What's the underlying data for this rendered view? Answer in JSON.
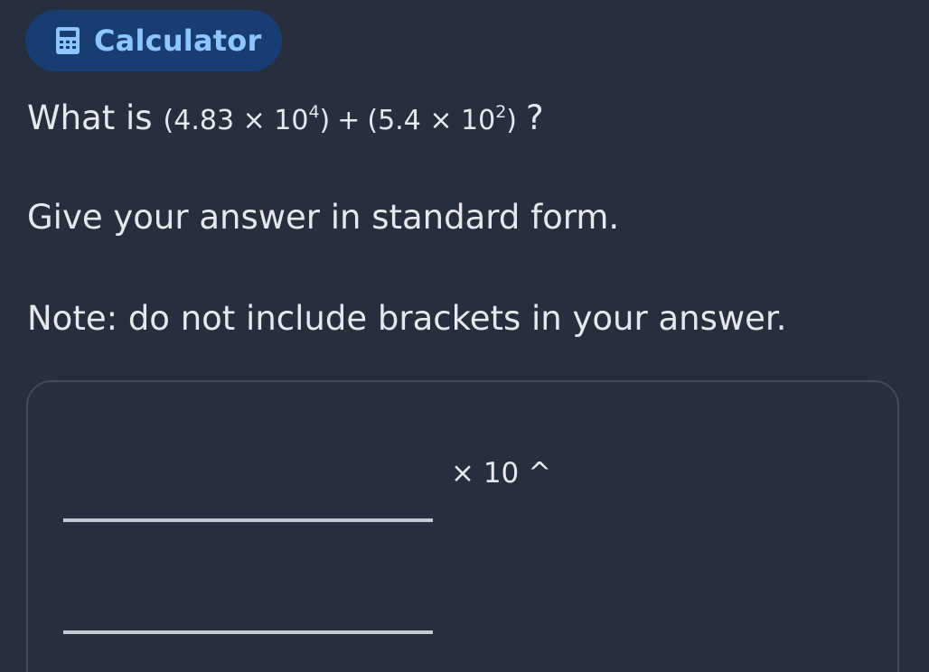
{
  "calculator_button": {
    "label": "Calculator",
    "icon": "calculator-icon",
    "background": "#173d73",
    "text_color": "#8ec5ff"
  },
  "question": {
    "prefix": "What is",
    "term1_open": "(4.83 × 10",
    "term1_exp": "4",
    "term1_close": ")",
    "operator": "+",
    "term2_open": "(5.4 × 10",
    "term2_exp": "2",
    "term2_close": ")",
    "suffix": "?"
  },
  "instructions": {
    "line1": "Give your answer in standard form.",
    "line2": "Note: do not include brackets in your answer."
  },
  "answer": {
    "multiplier_label": "× 10 ^",
    "mantissa_value": "",
    "exponent_value": ""
  },
  "colors": {
    "background": "#272f3f",
    "text": "#e6e8ee",
    "box_border": "#424b5c",
    "input_underline": "#c5c9d1"
  }
}
